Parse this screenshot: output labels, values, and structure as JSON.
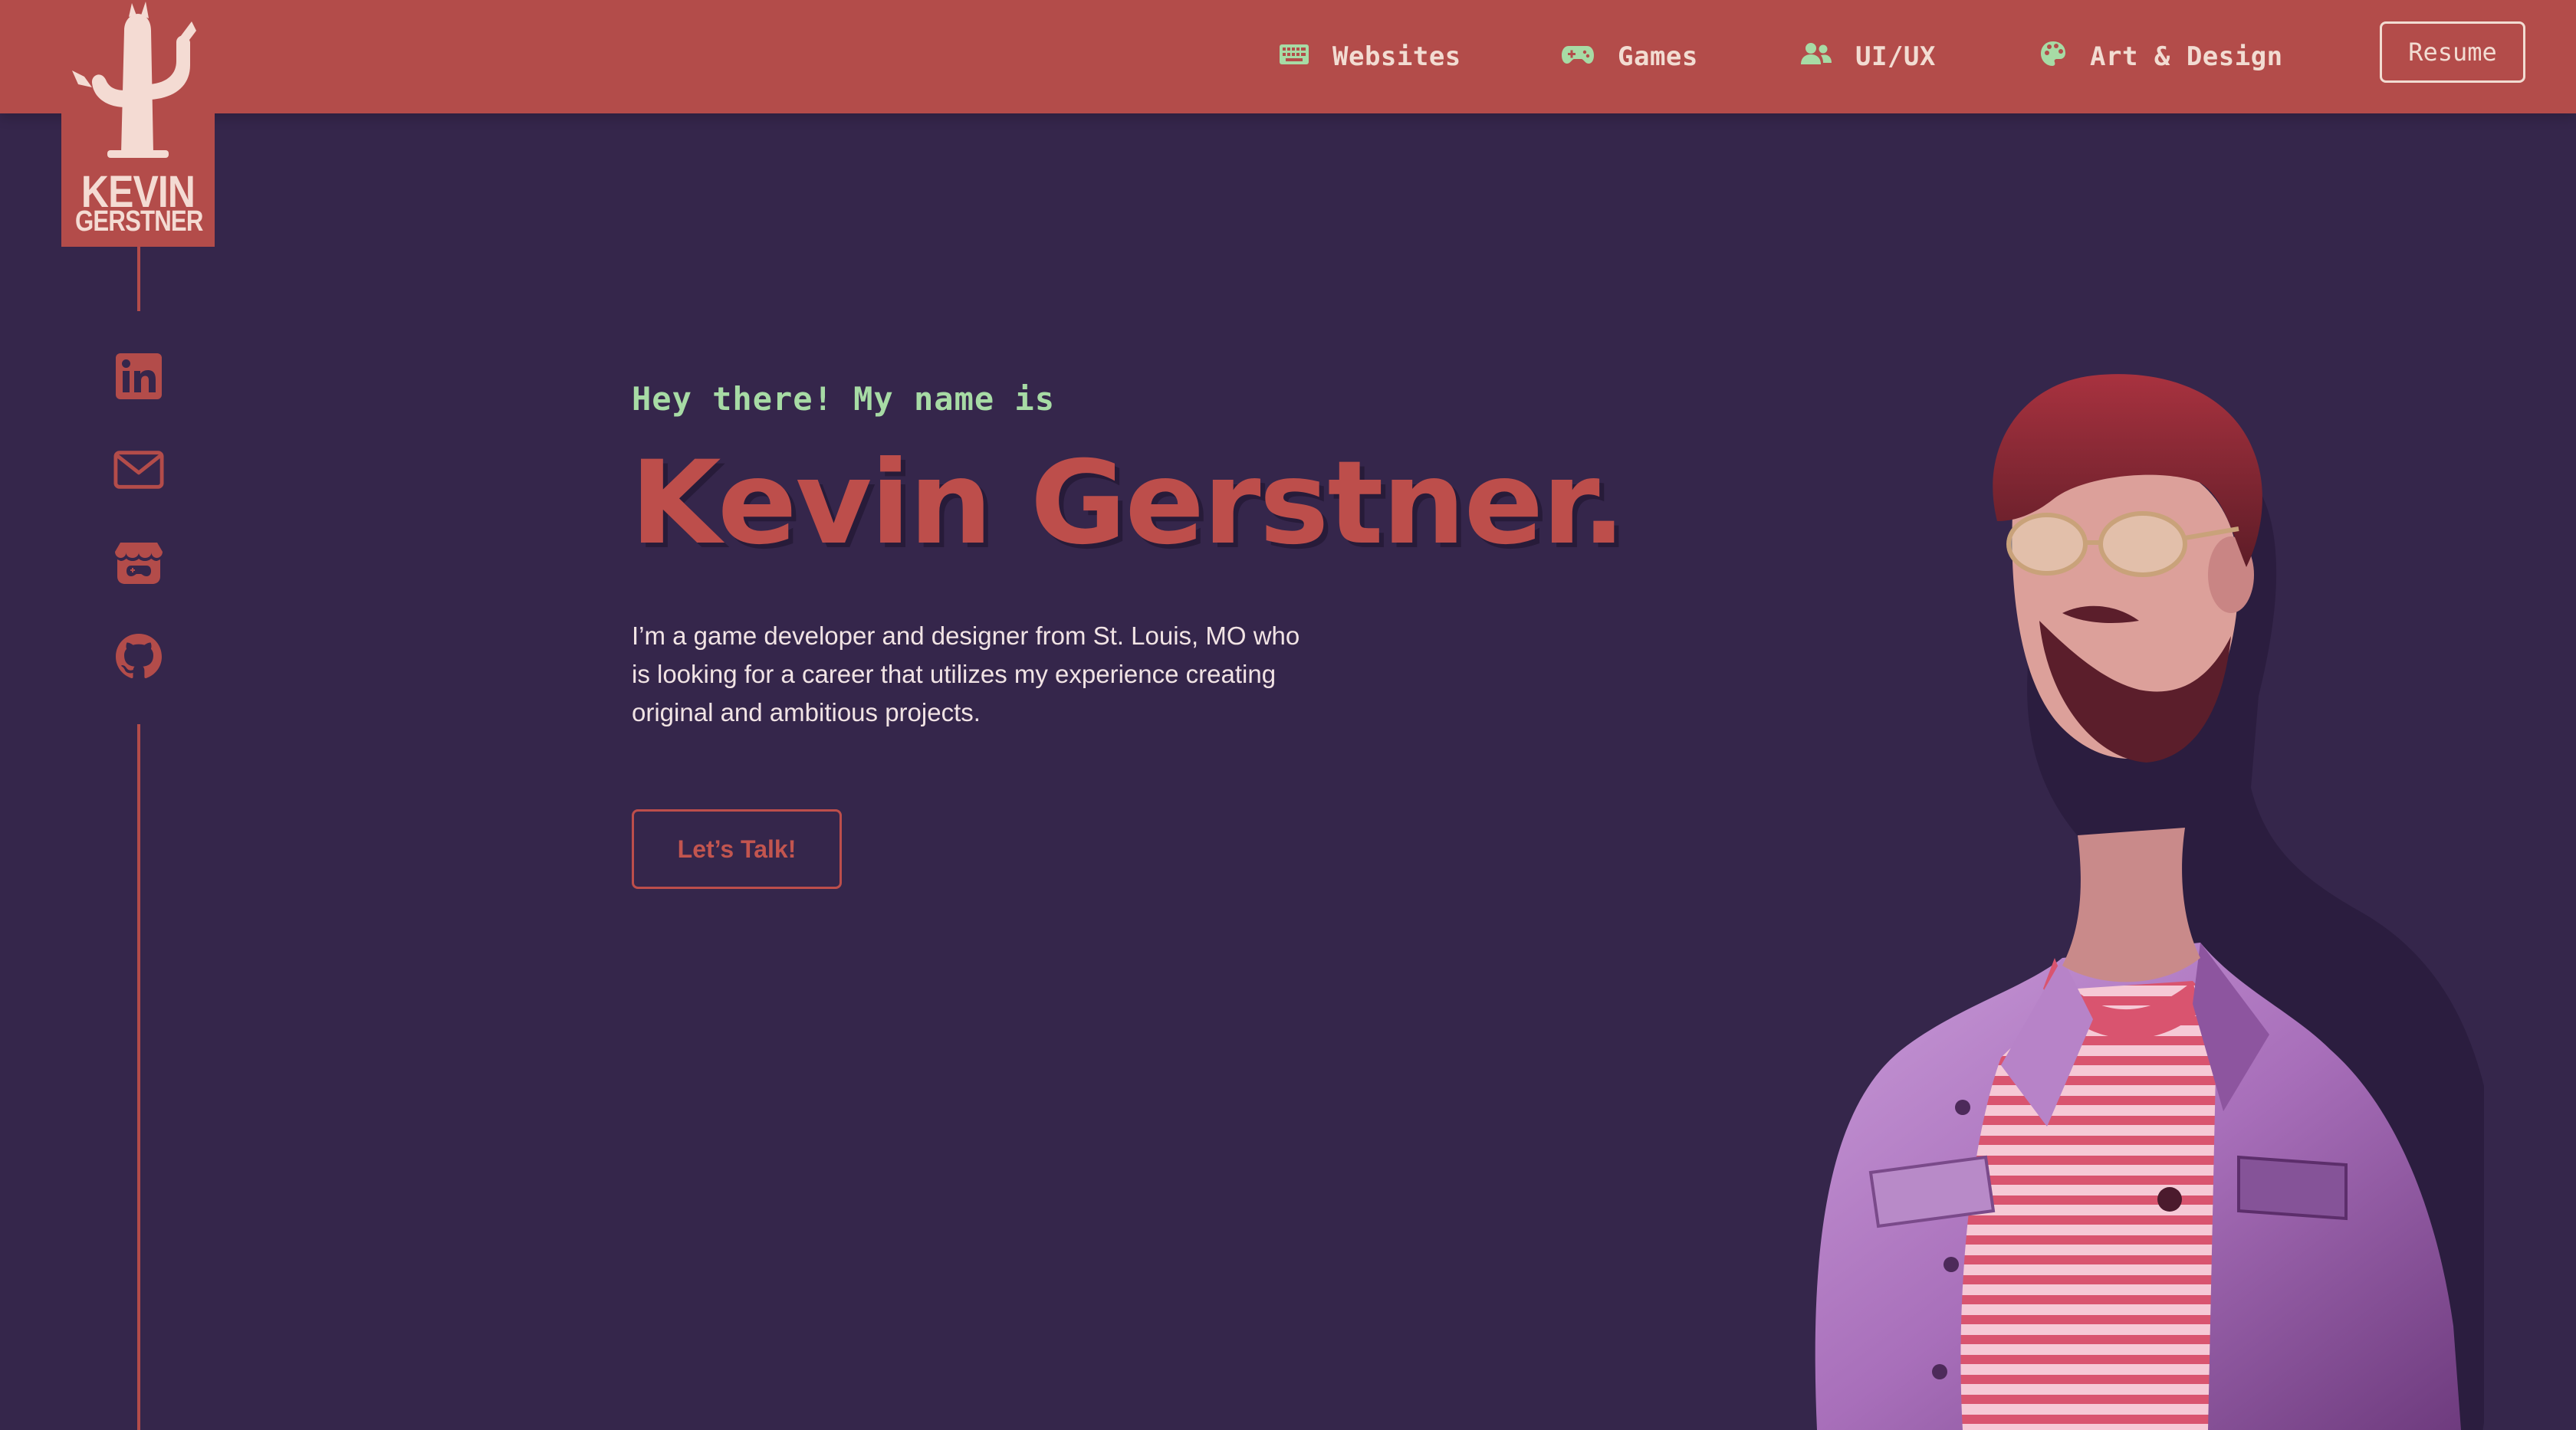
{
  "nav": {
    "items": [
      {
        "label": "Websites",
        "icon": "keyboard-icon"
      },
      {
        "label": "Games",
        "icon": "gamepad-icon"
      },
      {
        "label": "UI/UX",
        "icon": "users-icon"
      },
      {
        "label": "Art & Design",
        "icon": "palette-icon"
      }
    ],
    "resume_label": "Resume"
  },
  "logo": {
    "line1": "KEVIN",
    "line2": "GERSTNER",
    "icon": "cactus-icon"
  },
  "social": [
    {
      "icon": "linkedin-icon"
    },
    {
      "icon": "mail-icon"
    },
    {
      "icon": "itchio-icon"
    },
    {
      "icon": "github-icon"
    }
  ],
  "hero": {
    "greeting": "Hey there! My name is",
    "name": "Kevin Gerstner.",
    "description": "I’m a game developer and designer from St. Louis, MO who is looking for a career that utilizes my experience creating original and ambitious projects.",
    "cta_label": "Let’s Talk!"
  },
  "colors": {
    "background": "#35264b",
    "accent_red": "#b34c4a",
    "nav_text": "#f2dcd2",
    "greeting_green": "#a7dba5",
    "body_text": "#f1e3e4"
  }
}
